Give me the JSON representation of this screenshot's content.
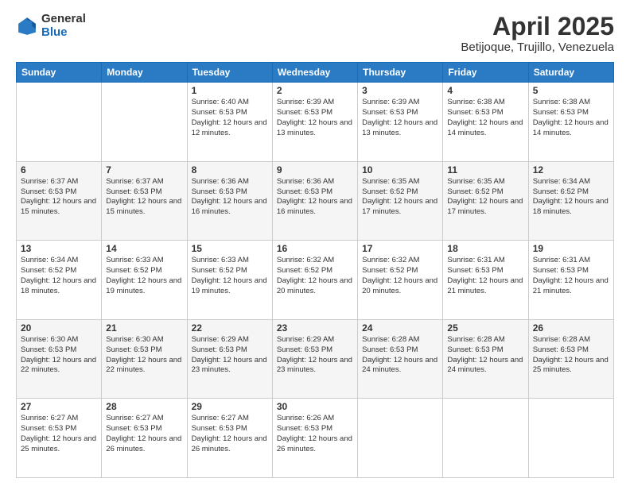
{
  "header": {
    "logo_general": "General",
    "logo_blue": "Blue",
    "title": "April 2025",
    "subtitle": "Betijoque, Trujillo, Venezuela"
  },
  "days_of_week": [
    "Sunday",
    "Monday",
    "Tuesday",
    "Wednesday",
    "Thursday",
    "Friday",
    "Saturday"
  ],
  "weeks": [
    [
      {
        "day": "",
        "info": ""
      },
      {
        "day": "",
        "info": ""
      },
      {
        "day": "1",
        "info": "Sunrise: 6:40 AM\nSunset: 6:53 PM\nDaylight: 12 hours and 12 minutes."
      },
      {
        "day": "2",
        "info": "Sunrise: 6:39 AM\nSunset: 6:53 PM\nDaylight: 12 hours and 13 minutes."
      },
      {
        "day": "3",
        "info": "Sunrise: 6:39 AM\nSunset: 6:53 PM\nDaylight: 12 hours and 13 minutes."
      },
      {
        "day": "4",
        "info": "Sunrise: 6:38 AM\nSunset: 6:53 PM\nDaylight: 12 hours and 14 minutes."
      },
      {
        "day": "5",
        "info": "Sunrise: 6:38 AM\nSunset: 6:53 PM\nDaylight: 12 hours and 14 minutes."
      }
    ],
    [
      {
        "day": "6",
        "info": "Sunrise: 6:37 AM\nSunset: 6:53 PM\nDaylight: 12 hours and 15 minutes."
      },
      {
        "day": "7",
        "info": "Sunrise: 6:37 AM\nSunset: 6:53 PM\nDaylight: 12 hours and 15 minutes."
      },
      {
        "day": "8",
        "info": "Sunrise: 6:36 AM\nSunset: 6:53 PM\nDaylight: 12 hours and 16 minutes."
      },
      {
        "day": "9",
        "info": "Sunrise: 6:36 AM\nSunset: 6:53 PM\nDaylight: 12 hours and 16 minutes."
      },
      {
        "day": "10",
        "info": "Sunrise: 6:35 AM\nSunset: 6:52 PM\nDaylight: 12 hours and 17 minutes."
      },
      {
        "day": "11",
        "info": "Sunrise: 6:35 AM\nSunset: 6:52 PM\nDaylight: 12 hours and 17 minutes."
      },
      {
        "day": "12",
        "info": "Sunrise: 6:34 AM\nSunset: 6:52 PM\nDaylight: 12 hours and 18 minutes."
      }
    ],
    [
      {
        "day": "13",
        "info": "Sunrise: 6:34 AM\nSunset: 6:52 PM\nDaylight: 12 hours and 18 minutes."
      },
      {
        "day": "14",
        "info": "Sunrise: 6:33 AM\nSunset: 6:52 PM\nDaylight: 12 hours and 19 minutes."
      },
      {
        "day": "15",
        "info": "Sunrise: 6:33 AM\nSunset: 6:52 PM\nDaylight: 12 hours and 19 minutes."
      },
      {
        "day": "16",
        "info": "Sunrise: 6:32 AM\nSunset: 6:52 PM\nDaylight: 12 hours and 20 minutes."
      },
      {
        "day": "17",
        "info": "Sunrise: 6:32 AM\nSunset: 6:52 PM\nDaylight: 12 hours and 20 minutes."
      },
      {
        "day": "18",
        "info": "Sunrise: 6:31 AM\nSunset: 6:53 PM\nDaylight: 12 hours and 21 minutes."
      },
      {
        "day": "19",
        "info": "Sunrise: 6:31 AM\nSunset: 6:53 PM\nDaylight: 12 hours and 21 minutes."
      }
    ],
    [
      {
        "day": "20",
        "info": "Sunrise: 6:30 AM\nSunset: 6:53 PM\nDaylight: 12 hours and 22 minutes."
      },
      {
        "day": "21",
        "info": "Sunrise: 6:30 AM\nSunset: 6:53 PM\nDaylight: 12 hours and 22 minutes."
      },
      {
        "day": "22",
        "info": "Sunrise: 6:29 AM\nSunset: 6:53 PM\nDaylight: 12 hours and 23 minutes."
      },
      {
        "day": "23",
        "info": "Sunrise: 6:29 AM\nSunset: 6:53 PM\nDaylight: 12 hours and 23 minutes."
      },
      {
        "day": "24",
        "info": "Sunrise: 6:28 AM\nSunset: 6:53 PM\nDaylight: 12 hours and 24 minutes."
      },
      {
        "day": "25",
        "info": "Sunrise: 6:28 AM\nSunset: 6:53 PM\nDaylight: 12 hours and 24 minutes."
      },
      {
        "day": "26",
        "info": "Sunrise: 6:28 AM\nSunset: 6:53 PM\nDaylight: 12 hours and 25 minutes."
      }
    ],
    [
      {
        "day": "27",
        "info": "Sunrise: 6:27 AM\nSunset: 6:53 PM\nDaylight: 12 hours and 25 minutes."
      },
      {
        "day": "28",
        "info": "Sunrise: 6:27 AM\nSunset: 6:53 PM\nDaylight: 12 hours and 26 minutes."
      },
      {
        "day": "29",
        "info": "Sunrise: 6:27 AM\nSunset: 6:53 PM\nDaylight: 12 hours and 26 minutes."
      },
      {
        "day": "30",
        "info": "Sunrise: 6:26 AM\nSunset: 6:53 PM\nDaylight: 12 hours and 26 minutes."
      },
      {
        "day": "",
        "info": ""
      },
      {
        "day": "",
        "info": ""
      },
      {
        "day": "",
        "info": ""
      }
    ]
  ]
}
